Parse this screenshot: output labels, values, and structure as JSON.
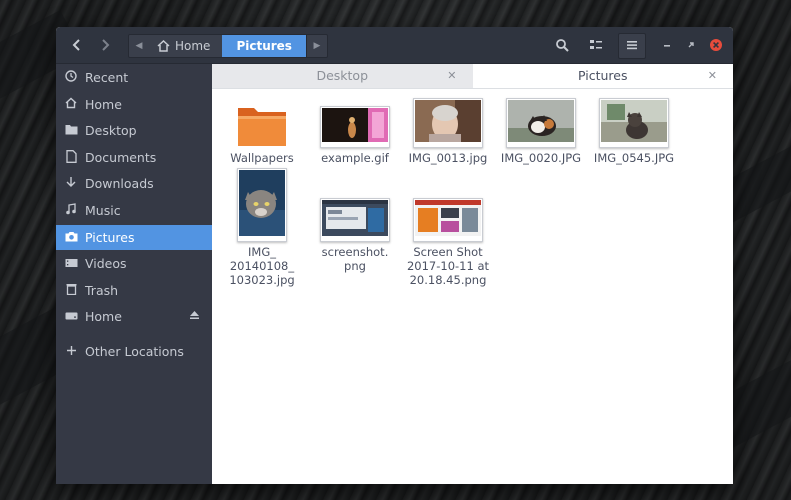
{
  "headerbar": {
    "back_icon": "back-arrow-icon",
    "forward_icon": "forward-arrow-icon",
    "path": [
      {
        "label": "Home",
        "icon": "home-icon"
      },
      {
        "label": "Pictures"
      }
    ]
  },
  "sidebar": {
    "items": [
      {
        "label": "Recent",
        "icon": "clock-icon"
      },
      {
        "label": "Home",
        "icon": "home-icon"
      },
      {
        "label": "Desktop",
        "icon": "folder-icon"
      },
      {
        "label": "Documents",
        "icon": "document-icon"
      },
      {
        "label": "Downloads",
        "icon": "download-icon"
      },
      {
        "label": "Music",
        "icon": "music-icon"
      },
      {
        "label": "Pictures",
        "icon": "camera-icon",
        "active": true
      },
      {
        "label": "Videos",
        "icon": "video-icon"
      },
      {
        "label": "Trash",
        "icon": "trash-icon"
      },
      {
        "label": "Home",
        "icon": "drive-icon"
      },
      {
        "label": "Other Locations",
        "icon": "plus-icon"
      }
    ]
  },
  "tabs": [
    {
      "label": "Desktop",
      "active": false
    },
    {
      "label": "Pictures",
      "active": true
    }
  ],
  "files": [
    {
      "name": "Wallpapers",
      "kind": "folder"
    },
    {
      "name": "example.gif",
      "kind": "image"
    },
    {
      "name": "IMG_0013.jpg",
      "kind": "image"
    },
    {
      "name": "IMG_0020.JPG",
      "kind": "image"
    },
    {
      "name": "IMG_0545.JPG",
      "kind": "image"
    },
    {
      "name": "IMG_\n20140108_\n103023.jpg",
      "kind": "image"
    },
    {
      "name": "screenshot.\npng",
      "kind": "image"
    },
    {
      "name": "Screen Shot\n2017-10-11 at\n20.18.45.png",
      "kind": "image"
    }
  ],
  "colors": {
    "accent": "#5294e2",
    "sidebar_bg": "#353945",
    "headerbar_bg": "#2f343f",
    "close": "#e74c3c"
  }
}
